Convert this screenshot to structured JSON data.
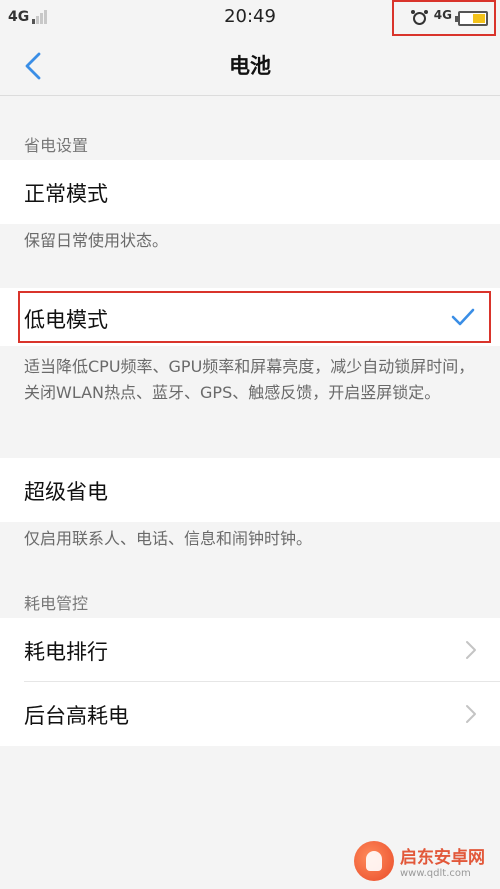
{
  "status_bar": {
    "network_left": "4G",
    "time": "20:49",
    "network_right": "4G"
  },
  "header": {
    "title": "电池"
  },
  "sections": {
    "power_saving": {
      "header": "省电设置",
      "normal_mode": {
        "label": "正常模式",
        "desc": "保留日常使用状态。"
      },
      "low_power_mode": {
        "label": "低电模式",
        "selected": true,
        "desc": "适当降低CPU频率、GPU频率和屏幕亮度，减少自动锁屏时间，关闭WLAN热点、蓝牙、GPS、触感反馈，开启竖屏锁定。"
      },
      "super_saving": {
        "label": "超级省电",
        "desc": "仅启用联系人、电话、信息和闹钟时钟。"
      }
    },
    "consumption": {
      "header": "耗电管控",
      "ranking": {
        "label": "耗电排行"
      },
      "background_high": {
        "label": "后台高耗电"
      }
    }
  },
  "watermark": {
    "name": "启东安卓网",
    "url": "www.qdlt.com"
  },
  "colors": {
    "accent": "#3a8ee6",
    "highlight_border": "#d9342b",
    "battery_fill": "#f2c21b"
  }
}
